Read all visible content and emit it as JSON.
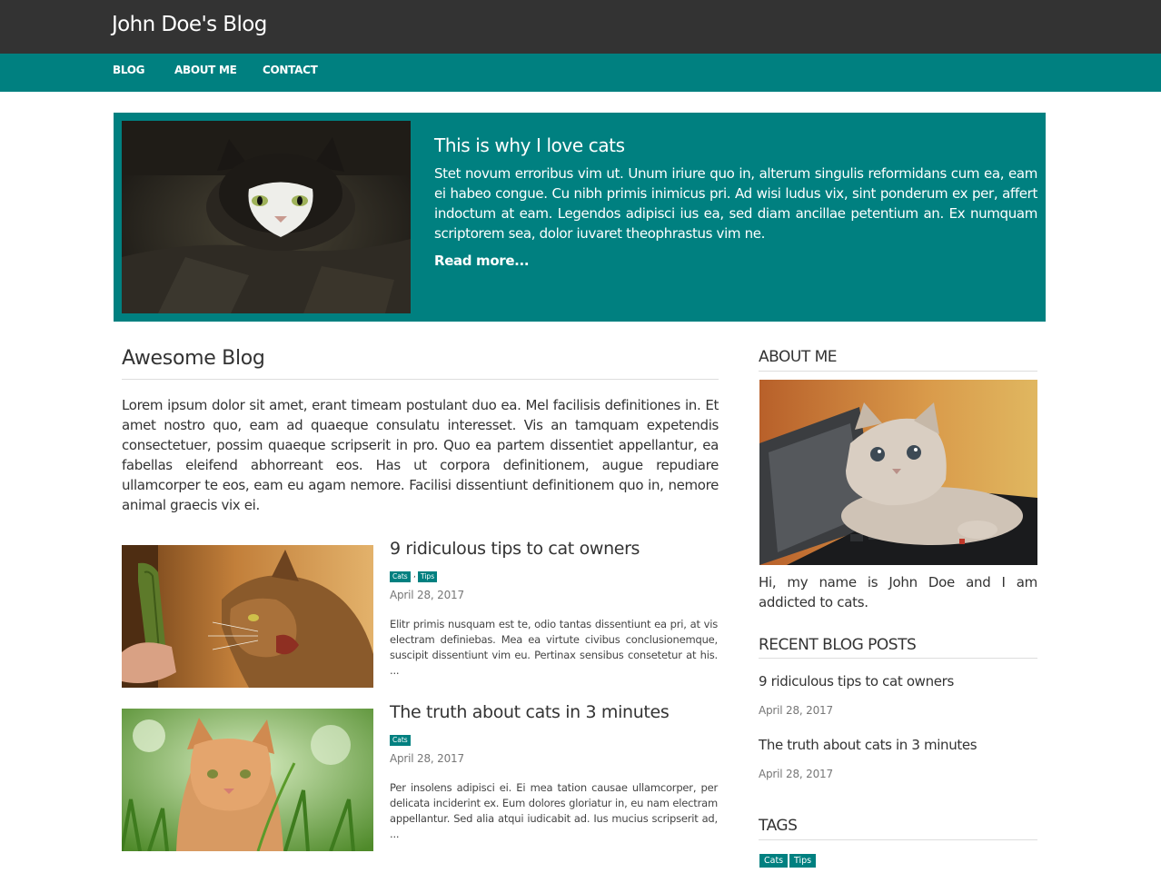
{
  "header": {
    "brand": "John Doe's Blog"
  },
  "nav": {
    "items": [
      "BLOG",
      "ABOUT ME",
      "CONTACT"
    ]
  },
  "featured": {
    "title": "This is why I love cats",
    "text": "Stet novum erroribus vim ut. Unum iriure quo in, alterum singulis reformidans cum ea, eam ei habeo congue. Cu nibh primis inimicus pri. Ad wisi ludus vix, sint ponderum ex per, affert indoctum at eam. Legendos adipisci ius ea, sed diam ancillae petentium an. Ex numquam scriptorem sea, dolor iuvaret theophrastus vim ne.",
    "read_more": "Read more..."
  },
  "main": {
    "title": "Awesome Blog",
    "intro": "Lorem ipsum dolor sit amet, erant timeam postulant duo ea. Mel facilisis definitiones in. Et amet nostro quo, eam ad quaeque consulatu interesset. Vis an tamquam expetendis consectetuer, possim quaeque scripserit in pro. Quo ea partem dissentiet appellantur, ea fabellas eleifend abhorreant eos. Has ut corpora definitionem, augue repudiare ullamcorper te eos, eam eu agam nemore. Facilisi dissentiunt definitionem quo in, nemore animal graecis vix ei.",
    "posts": [
      {
        "title": "9 ridiculous tips to cat owners",
        "tags": [
          "Cats",
          "Tips"
        ],
        "tag_separator": ",",
        "date": "April 28, 2017",
        "excerpt": "Elitr primis nusquam est te, odio tantas dissentiunt ea pri, at vis electram definiebas. Mea ea virtute civibus conclusionemque, suscipit dissentiunt vim eu. Pertinax sensibus consetetur at his. ..."
      },
      {
        "title": "The truth about cats in 3 minutes",
        "tags": [
          "Cats"
        ],
        "date": "April 28, 2017",
        "excerpt": "Per insolens adipisci ei. Ei mea tation causae ullamcorper, per delicata inciderint ex. Eum dolores gloriatur in, eu nam electram appellantur. Sed alia atqui iudicabit ad. Ius mucius scripserit ad, ..."
      }
    ]
  },
  "sidebar": {
    "about_heading": "ABOUT ME",
    "about_text": "Hi, my name is John Doe and I am addicted to cats.",
    "recent_heading": "RECENT BLOG POSTS",
    "recent": [
      {
        "title": "9 ridiculous tips to cat owners",
        "date": "April 28, 2017"
      },
      {
        "title": "The truth about cats in 3 minutes",
        "date": "April 28, 2017"
      }
    ],
    "tags_heading": "TAGS",
    "tags": [
      "Cats",
      "Tips"
    ]
  },
  "colors": {
    "header_bg": "#333333",
    "accent": "#008080",
    "text": "#333333",
    "muted": "#777777"
  }
}
